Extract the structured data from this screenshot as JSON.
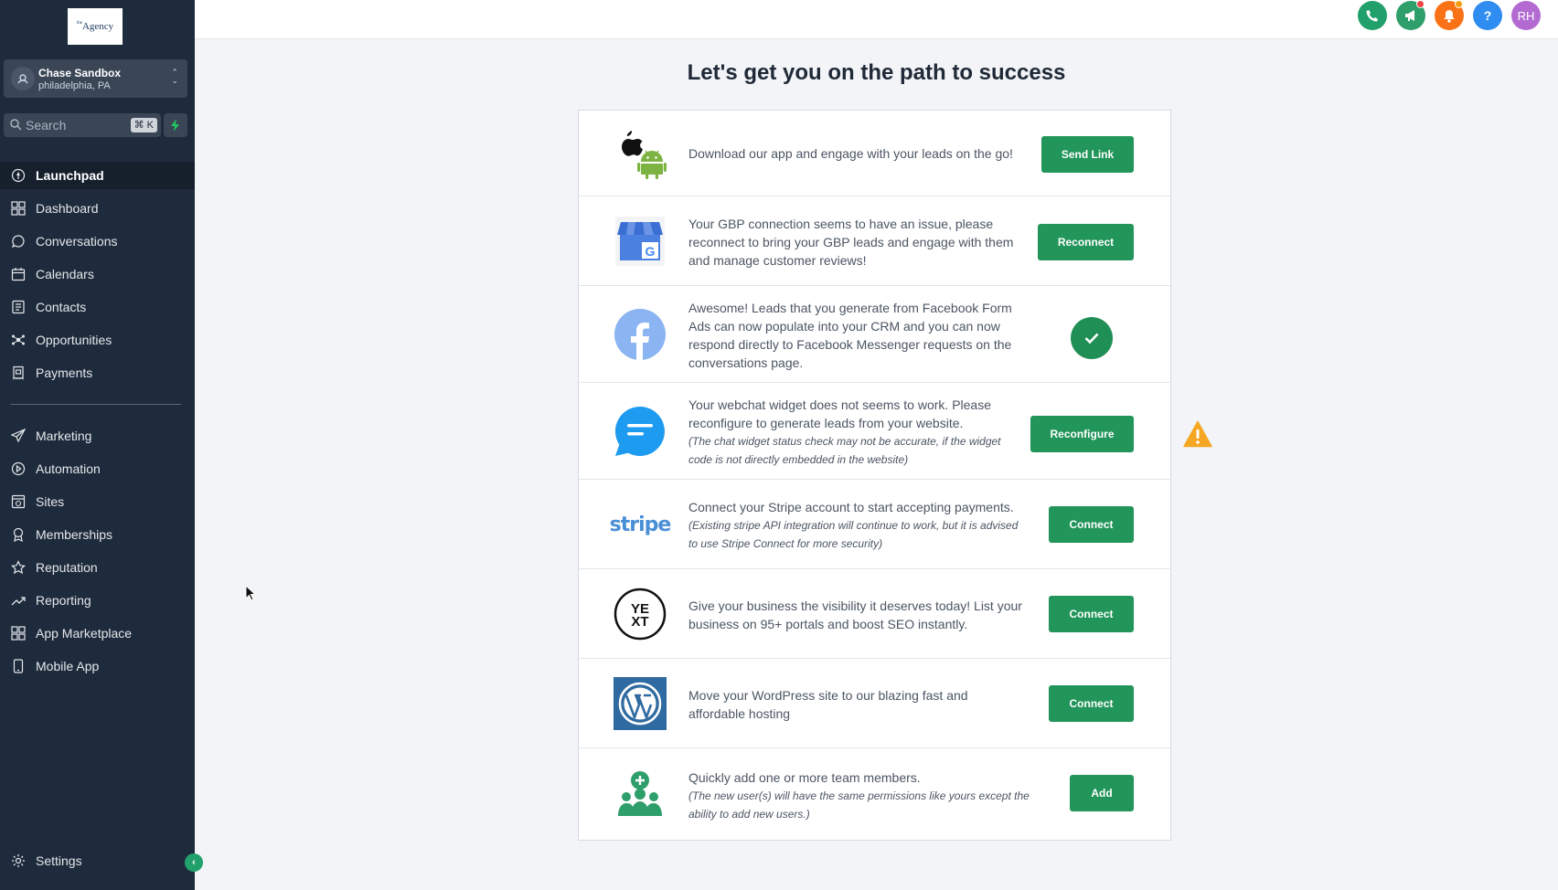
{
  "sidebar": {
    "logo_text": "Agency",
    "logo_prefix": "the",
    "account": {
      "name": "Chase Sandbox",
      "location": "philadelphia, PA"
    },
    "search": {
      "placeholder": "Search",
      "shortcut": "⌘ K"
    },
    "nav_main": [
      {
        "label": "Launchpad",
        "icon": "rocket-icon",
        "active": true
      },
      {
        "label": "Dashboard",
        "icon": "grid-icon"
      },
      {
        "label": "Conversations",
        "icon": "chat-bubble-icon"
      },
      {
        "label": "Calendars",
        "icon": "calendar-icon"
      },
      {
        "label": "Contacts",
        "icon": "contact-card-icon"
      },
      {
        "label": "Opportunities",
        "icon": "network-icon"
      },
      {
        "label": "Payments",
        "icon": "receipt-icon"
      }
    ],
    "nav_secondary": [
      {
        "label": "Marketing",
        "icon": "send-icon"
      },
      {
        "label": "Automation",
        "icon": "play-circle-icon"
      },
      {
        "label": "Sites",
        "icon": "globe-box-icon"
      },
      {
        "label": "Memberships",
        "icon": "badge-icon"
      },
      {
        "label": "Reputation",
        "icon": "star-icon"
      },
      {
        "label": "Reporting",
        "icon": "trend-up-icon"
      },
      {
        "label": "App Marketplace",
        "icon": "apps-grid-icon"
      },
      {
        "label": "Mobile App",
        "icon": "phone-device-icon"
      }
    ],
    "settings_label": "Settings"
  },
  "topbar": {
    "user_initials": "RH",
    "help_label": "?",
    "colors": {
      "phone": "#22a06b",
      "announce": "#2e9e6a",
      "bell": "#f97316",
      "help": "#2f8cf0",
      "avatar": "#b36bd1"
    }
  },
  "main": {
    "title": "Let's get you on the path to success",
    "rows": [
      {
        "icon": "apple-android-icon",
        "text": "Download our app and engage with your leads on the go!",
        "note": "",
        "action": "Send Link"
      },
      {
        "icon": "google-business-icon",
        "text": "Your GBP connection seems to have an issue, please reconnect to bring your GBP leads and engage with them and manage customer reviews!",
        "note": "",
        "action": "Reconnect"
      },
      {
        "icon": "facebook-icon",
        "text": "Awesome! Leads that you generate from Facebook Form Ads can now populate into your CRM and you can now respond directly to Facebook Messenger requests on the conversations page.",
        "note": "",
        "action": ""
      },
      {
        "icon": "webchat-icon",
        "text": "Your webchat widget does not seems to work. Please reconfigure to generate leads from your website.",
        "note": "(The chat widget status check may not be accurate, if the widget code is not directly embedded in the website)",
        "action": "Reconfigure"
      },
      {
        "icon": "stripe-logo",
        "logo_text": "stripe",
        "text": "Connect your Stripe account to start accepting payments.",
        "note": "(Existing stripe API integration will continue to work, but it is advised to use Stripe Connect for more security)",
        "action": "Connect"
      },
      {
        "icon": "yext-logo",
        "logo_text": "YEXT",
        "text": "Give your business the visibility it deserves today! List your business on 95+ portals and boost SEO instantly.",
        "note": "",
        "action": "Connect"
      },
      {
        "icon": "wordpress-icon",
        "text": "Move your WordPress site to our blazing fast and affordable hosting",
        "note": "",
        "action": "Connect"
      },
      {
        "icon": "team-add-icon",
        "text": "Quickly add one or more team members.",
        "note": "(The new user(s) will have the same permissions like yours except the ability to add new users.)",
        "action": "Add"
      }
    ]
  },
  "colors": {
    "sidebar_bg": "#1e2b3c",
    "button_green": "#22955a",
    "warning": "#f5a623"
  }
}
